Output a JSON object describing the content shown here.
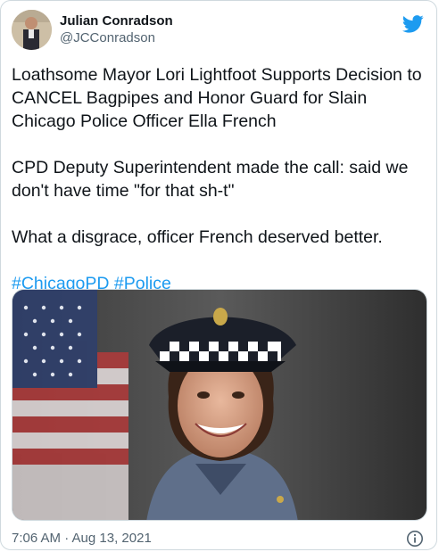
{
  "author": {
    "display_name": "Julian Conradson",
    "handle": "@JCConradson"
  },
  "tweet": {
    "paragraphs": [
      "Loathsome Mayor Lori Lightfoot Supports Decision to CANCEL Bagpipes and Honor Guard for Slain Chicago Police Officer Ella French",
      "CPD Deputy Superintendent made the call: said we don't have time \"for that sh-t\"",
      "What a disgrace, officer French deserved better."
    ],
    "hashtags": "#ChicagoPD #Police"
  },
  "meta": {
    "timestamp": "7:06 AM · Aug 13, 2021"
  },
  "icons": {
    "brand": "twitter-bird-icon",
    "info": "info-icon"
  },
  "colors": {
    "brand_blue": "#1d9bf0",
    "text_primary": "#0f1419",
    "text_secondary": "#536471"
  }
}
